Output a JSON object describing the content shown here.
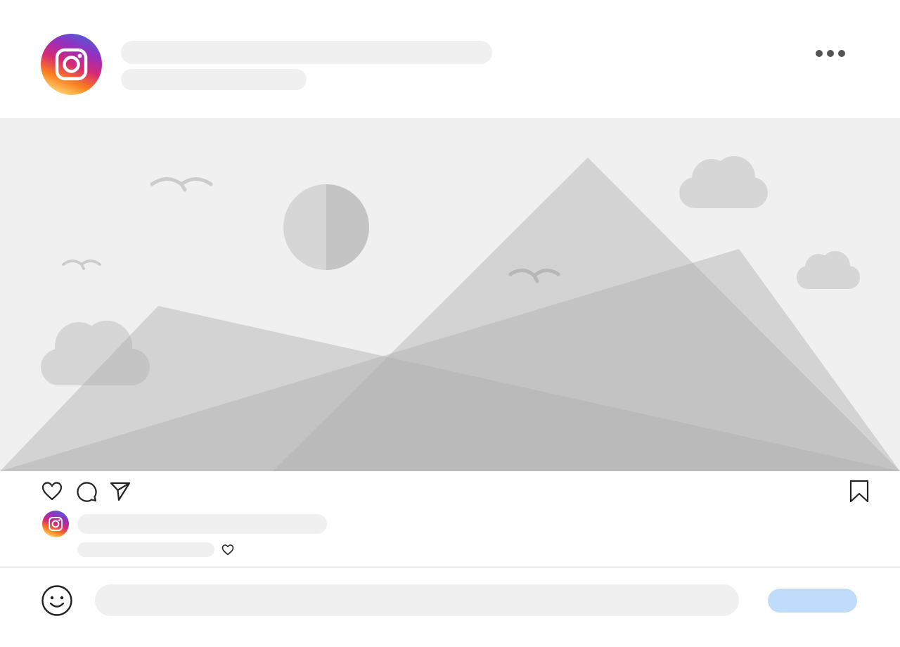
{
  "post": {
    "author": {
      "avatar_icon": "instagram-logo-icon",
      "name": "",
      "subtitle": ""
    },
    "menu_icon": "more-horizontal-icon",
    "image": {
      "icon": "image-placeholder-icon",
      "alt": ""
    },
    "actions": {
      "like_icon": "heart-icon",
      "comment_icon": "comment-bubble-icon",
      "share_icon": "paper-plane-icon",
      "save_icon": "bookmark-icon"
    },
    "caption": {
      "avatar_icon": "instagram-logo-icon",
      "text": "",
      "likes": "",
      "like_icon": "small-heart-icon"
    }
  },
  "comment_bar": {
    "emoji_icon": "smiley-face-icon",
    "input_value": "",
    "input_placeholder": "",
    "post_label": ""
  },
  "colors": {
    "gradient": [
      "#4f5bd5",
      "#962fbf",
      "#d62976",
      "#fa7e1e",
      "#feda75"
    ],
    "skeleton": "#f0f0f0",
    "post_button": "#bfdcfa",
    "icon_stroke": "#222222"
  }
}
